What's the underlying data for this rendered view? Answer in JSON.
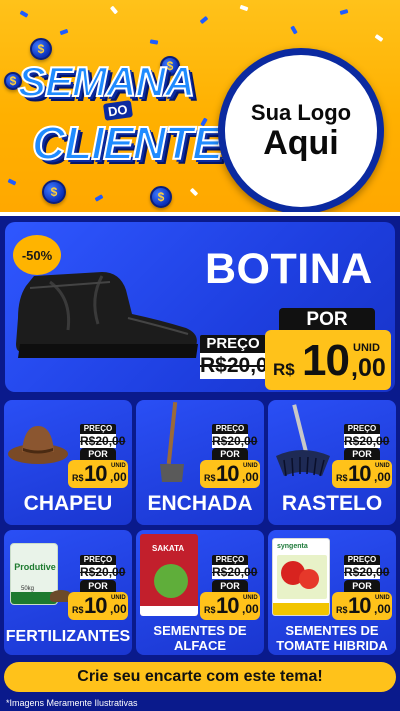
{
  "header": {
    "brand_line1": "SEMANA",
    "brand_do": "DO",
    "brand_line2": "CLIENTE",
    "logo_line1": "Sua Logo",
    "logo_line2": "Aqui"
  },
  "hero": {
    "discount": "-50%",
    "title": "BOTINA",
    "preco_label": "PREÇO",
    "old_price": "R$20,00",
    "por_label": "POR",
    "currency": "R$",
    "price_int": "10",
    "price_cents": ",00",
    "unit": "UNID"
  },
  "products": [
    {
      "name": "CHAPEU",
      "preco_label": "PREÇO",
      "old_price": "R$20,00",
      "por_label": "POR",
      "currency": "R$",
      "price_int": "10",
      "price_cents": ",00",
      "unit": "UNID"
    },
    {
      "name": "ENCHADA",
      "preco_label": "PREÇO",
      "old_price": "R$20,00",
      "por_label": "POR",
      "currency": "R$",
      "price_int": "10",
      "price_cents": ",00",
      "unit": "UNID"
    },
    {
      "name": "RASTELO",
      "preco_label": "PREÇO",
      "old_price": "R$20,00",
      "por_label": "POR",
      "currency": "R$",
      "price_int": "10",
      "price_cents": ",00",
      "unit": "UNID"
    },
    {
      "name": "FERTILIZANTES",
      "preco_label": "PREÇO",
      "old_price": "R$20,00",
      "por_label": "POR",
      "currency": "R$",
      "price_int": "10",
      "price_cents": ",00",
      "unit": "UNID",
      "package_text": "Produtive",
      "package_weight": "50kg"
    },
    {
      "name_line1": "SEMENTES DE",
      "name_line2": "ALFACE",
      "preco_label": "PREÇO",
      "old_price": "R$20,00",
      "por_label": "POR",
      "currency": "R$",
      "price_int": "10",
      "price_cents": ",00",
      "unit": "UNID",
      "package_text": "SAKATA"
    },
    {
      "name_line1": "SEMENTES DE",
      "name_line2": "TOMATE HIBRIDA",
      "preco_label": "PREÇO",
      "old_price": "R$20,00",
      "por_label": "POR",
      "currency": "R$",
      "price_int": "10",
      "price_cents": ",00",
      "unit": "UNID",
      "package_text": "syngenta"
    }
  ],
  "cta": "Crie seu encarte com este tema!",
  "disclaimer": "*Imagens Meramente Ilustrativas",
  "colors": {
    "yellow": "#ffc21a",
    "blue": "#0a1a8c",
    "card_blue": "#1e3fe0"
  }
}
